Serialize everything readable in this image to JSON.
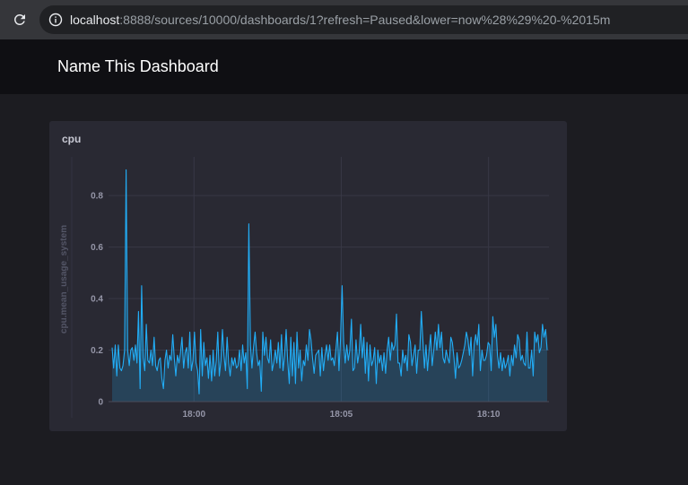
{
  "browser": {
    "url_host": "localhost",
    "url_rest": ":8888/sources/10000/dashboards/1?refresh=Paused&lower=now%28%29%20-%2015m",
    "reload_icon": "reload-icon",
    "info_icon": "info-icon"
  },
  "dashboard": {
    "title": "Name This Dashboard"
  },
  "cell": {
    "title": "cpu"
  },
  "colors": {
    "line": "#22adf6",
    "fill": "#22adf6",
    "grid": "#383846",
    "cell_bg": "#292933"
  },
  "chart_data": {
    "type": "area",
    "title": "cpu",
    "xlabel": "",
    "ylabel": "cpu.mean_usage_system",
    "ylim": [
      0,
      0.95
    ],
    "yticks": [
      {
        "value": 0,
        "label": "0"
      },
      {
        "value": 0.2,
        "label": "0.2"
      },
      {
        "value": 0.4,
        "label": "0.4"
      },
      {
        "value": 0.6,
        "label": "0.6"
      },
      {
        "value": 0.8,
        "label": "0.8"
      }
    ],
    "x_range_minutes": [
      -2.9,
      12.05
    ],
    "xticks": [
      {
        "value": 0,
        "label": "18:00"
      },
      {
        "value": 5,
        "label": "18:05"
      },
      {
        "value": 10,
        "label": "18:10"
      }
    ],
    "series": [
      {
        "values": [
          0.21,
          0.13,
          0.22,
          0.1,
          0.22,
          0.13,
          0.12,
          0.14,
          0.2,
          0.9,
          0.2,
          0.14,
          0.2,
          0.21,
          0.16,
          0.22,
          0.15,
          0.35,
          0.05,
          0.45,
          0.17,
          0.12,
          0.3,
          0.16,
          0.15,
          0.2,
          0.14,
          0.25,
          0.14,
          0.12,
          0.16,
          0.17,
          0.09,
          0.05,
          0.16,
          0.2,
          0.13,
          0.18,
          0.16,
          0.26,
          0.17,
          0.1,
          0.18,
          0.15,
          0.19,
          0.25,
          0.13,
          0.19,
          0.21,
          0.13,
          0.27,
          0.12,
          0.16,
          0.27,
          0.15,
          0.12,
          0.03,
          0.28,
          0.1,
          0.23,
          0.14,
          0.17,
          0.09,
          0.18,
          0.08,
          0.2,
          0.1,
          0.16,
          0.27,
          0.1,
          0.16,
          0.28,
          0.18,
          0.12,
          0.25,
          0.15,
          0.1,
          0.17,
          0.14,
          0.17,
          0.13,
          0.14,
          0.2,
          0.12,
          0.22,
          0.15,
          0.19,
          0.05,
          0.69,
          0.22,
          0.13,
          0.21,
          0.27,
          0.19,
          0.14,
          0.16,
          0.04,
          0.27,
          0.18,
          0.25,
          0.17,
          0.15,
          0.24,
          0.12,
          0.15,
          0.2,
          0.15,
          0.23,
          0.13,
          0.26,
          0.12,
          0.18,
          0.28,
          0.16,
          0.07,
          0.25,
          0.1,
          0.23,
          0.07,
          0.27,
          0.13,
          0.2,
          0.08,
          0.16,
          0.14,
          0.22,
          0.16,
          0.28,
          0.24,
          0.17,
          0.11,
          0.18,
          0.19,
          0.2,
          0.1,
          0.21,
          0.12,
          0.18,
          0.22,
          0.16,
          0.22,
          0.16,
          0.17,
          0.14,
          0.2,
          0.27,
          0.12,
          0.24,
          0.45,
          0.23,
          0.15,
          0.22,
          0.16,
          0.2,
          0.32,
          0.12,
          0.13,
          0.24,
          0.15,
          0.19,
          0.3,
          0.17,
          0.25,
          0.11,
          0.23,
          0.08,
          0.22,
          0.14,
          0.16,
          0.21,
          0.07,
          0.2,
          0.15,
          0.18,
          0.12,
          0.19,
          0.11,
          0.2,
          0.25,
          0.16,
          0.23,
          0.2,
          0.22,
          0.34,
          0.15,
          0.15,
          0.1,
          0.2,
          0.15,
          0.18,
          0.12,
          0.26,
          0.23,
          0.14,
          0.18,
          0.22,
          0.11,
          0.2,
          0.2,
          0.35,
          0.24,
          0.13,
          0.22,
          0.12,
          0.2,
          0.26,
          0.14,
          0.2,
          0.27,
          0.2,
          0.3,
          0.21,
          0.27,
          0.17,
          0.15,
          0.2,
          0.17,
          0.15,
          0.25,
          0.23,
          0.17,
          0.09,
          0.19,
          0.13,
          0.14,
          0.16,
          0.19,
          0.22,
          0.27,
          0.24,
          0.18,
          0.25,
          0.1,
          0.22,
          0.26,
          0.22,
          0.3,
          0.12,
          0.2,
          0.16,
          0.16,
          0.18,
          0.23,
          0.22,
          0.12,
          0.33,
          0.25,
          0.3,
          0.18,
          0.13,
          0.19,
          0.12,
          0.17,
          0.13,
          0.15,
          0.18,
          0.1,
          0.18,
          0.14,
          0.22,
          0.17,
          0.26,
          0.24,
          0.16,
          0.18,
          0.15,
          0.14,
          0.27,
          0.13,
          0.13,
          0.2,
          0.1,
          0.27,
          0.23,
          0.26,
          0.19,
          0.21,
          0.3,
          0.25,
          0.28,
          0.2
        ]
      }
    ],
    "grid": true,
    "legend": "none"
  }
}
